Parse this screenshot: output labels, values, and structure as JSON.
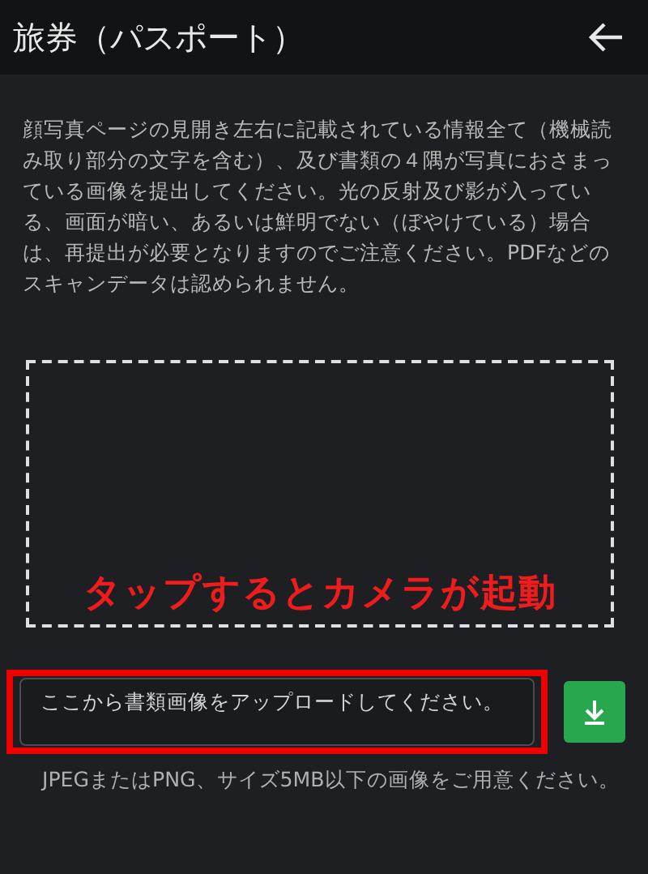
{
  "header": {
    "title": "旅券（パスポート）"
  },
  "instructions": "顔写真ページの見開き左右に記載されている情報全て（機械読み取り部分の文字を含む）、及び書類の４隅が写真におさまっている画像を提出してください。光の反射及び影が入っている、画面が暗い、あるいは鮮明でない（ぼやけている）場合は、再提出が必要となりますのでご注意ください。PDFなどのスキャンデータは認められません。",
  "camera_area": {
    "annotation": "タップするとカメラが起動"
  },
  "upload": {
    "placeholder": "ここから書類画像をアップロードしてください。",
    "highlighted": true
  },
  "note": "JPEGまたはPNG、サイズ5MB以下の画像をご用意ください。"
}
